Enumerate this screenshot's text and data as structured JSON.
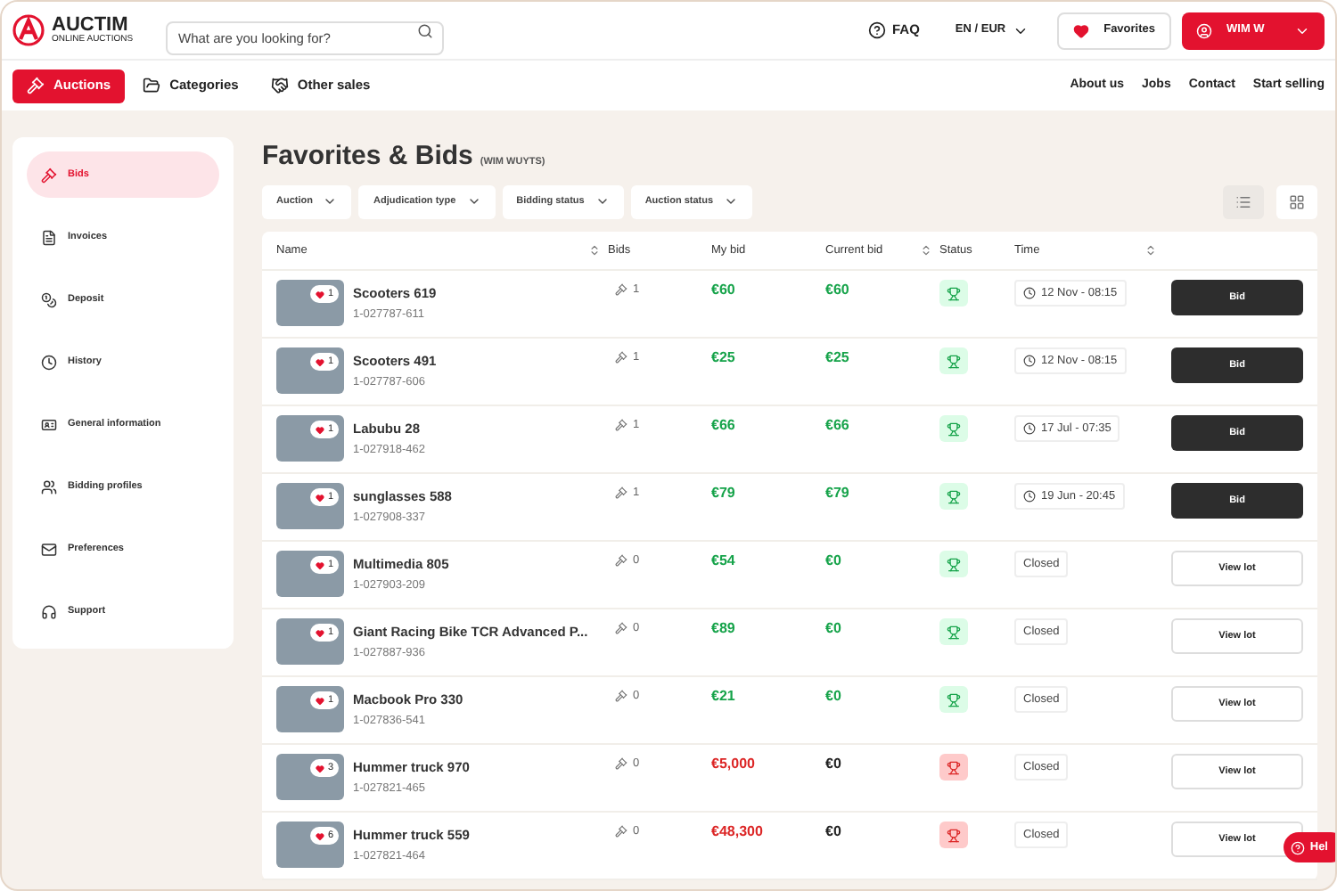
{
  "header": {
    "brand": "AUCTIM",
    "brand_tagline": "ONLINE AUCTIONS",
    "search": {
      "placeholder": "What are you looking for?"
    },
    "faq": "FAQ",
    "locale": "EN / EUR",
    "favorites": "Favorites",
    "user": "WIM W"
  },
  "nav": {
    "items": [
      {
        "label": "Auctions",
        "selected": true
      },
      {
        "label": "Categories",
        "selected": false
      },
      {
        "label": "Other sales",
        "selected": false
      }
    ],
    "links": [
      "About us",
      "Jobs",
      "Contact",
      "Start selling"
    ]
  },
  "sidebar": {
    "items": [
      {
        "label": "Bids",
        "selected": true
      },
      {
        "label": "Invoices",
        "selected": false
      },
      {
        "label": "Deposit",
        "selected": false
      },
      {
        "label": "History",
        "selected": false
      },
      {
        "label": "General information",
        "selected": false
      },
      {
        "label": "Bidding profiles",
        "selected": false
      },
      {
        "label": "Preferences",
        "selected": false
      },
      {
        "label": "Support",
        "selected": false
      }
    ]
  },
  "page": {
    "title": "Favorites & Bids",
    "subtitle": "(WIM WUYTS)"
  },
  "filters": [
    "Auction",
    "Adjudication type",
    "Bidding status",
    "Auction status"
  ],
  "view_toggle": [
    {
      "kind": "list",
      "selected": true
    },
    {
      "kind": "grid",
      "selected": false
    }
  ],
  "table": {
    "columns": [
      {
        "label": "Name",
        "sortable": true
      },
      {
        "label": "Bids",
        "sortable": false
      },
      {
        "label": "My bid",
        "sortable": false
      },
      {
        "label": "Current bid",
        "sortable": true
      },
      {
        "label": "Status",
        "sortable": false
      },
      {
        "label": "Time",
        "sortable": true
      }
    ],
    "rows": [
      {
        "name": "Scooters 619",
        "lot": "1-027787-611",
        "likes": "1",
        "bids": "1",
        "my_bid": "€60",
        "current_bid": "€60",
        "won": true,
        "time": {
          "kind": "timer",
          "text": "12 Nov - 08:15"
        },
        "action": {
          "kind": "bid",
          "label": "Bid"
        }
      },
      {
        "name": "Scooters 491",
        "lot": "1-027787-606",
        "likes": "1",
        "bids": "1",
        "my_bid": "€25",
        "current_bid": "€25",
        "won": true,
        "time": {
          "kind": "timer",
          "text": "12 Nov - 08:15"
        },
        "action": {
          "kind": "bid",
          "label": "Bid"
        }
      },
      {
        "name": "Labubu 28",
        "lot": "1-027918-462",
        "likes": "1",
        "bids": "1",
        "my_bid": "€66",
        "current_bid": "€66",
        "won": true,
        "time": {
          "kind": "timer",
          "text": "17 Jul - 07:35"
        },
        "action": {
          "kind": "bid",
          "label": "Bid"
        }
      },
      {
        "name": "sunglasses 588",
        "lot": "1-027908-337",
        "likes": "1",
        "bids": "1",
        "my_bid": "€79",
        "current_bid": "€79",
        "won": true,
        "time": {
          "kind": "timer",
          "text": "19 Jun - 20:45"
        },
        "action": {
          "kind": "bid",
          "label": "Bid"
        }
      },
      {
        "name": "Multimedia 805",
        "lot": "1-027903-209",
        "likes": "1",
        "bids": "0",
        "my_bid": "€54",
        "current_bid": "€0",
        "won": true,
        "time": {
          "kind": "closed",
          "text": "Closed"
        },
        "action": {
          "kind": "view",
          "label": "View lot"
        }
      },
      {
        "name": "Giant Racing Bike TCR Advanced P...",
        "lot": "1-027887-936",
        "likes": "1",
        "bids": "0",
        "my_bid": "€89",
        "current_bid": "€0",
        "won": true,
        "time": {
          "kind": "closed",
          "text": "Closed"
        },
        "action": {
          "kind": "view",
          "label": "View lot"
        }
      },
      {
        "name": "Macbook Pro 330",
        "lot": "1-027836-541",
        "likes": "1",
        "bids": "0",
        "my_bid": "€21",
        "current_bid": "€0",
        "won": true,
        "time": {
          "kind": "closed",
          "text": "Closed"
        },
        "action": {
          "kind": "view",
          "label": "View lot"
        }
      },
      {
        "name": "Hummer truck 970",
        "lot": "1-027821-465",
        "likes": "3",
        "bids": "0",
        "my_bid": "€5,000",
        "current_bid": "€0",
        "won": false,
        "time": {
          "kind": "closed",
          "text": "Closed"
        },
        "action": {
          "kind": "view",
          "label": "View lot"
        }
      },
      {
        "name": "Hummer truck 559",
        "lot": "1-027821-464",
        "likes": "6",
        "bids": "0",
        "my_bid": "€48,300",
        "current_bid": "€0",
        "won": false,
        "time": {
          "kind": "closed",
          "text": "Closed"
        },
        "action": {
          "kind": "view",
          "label": "View lot"
        }
      }
    ]
  },
  "help_button": "Hel"
}
